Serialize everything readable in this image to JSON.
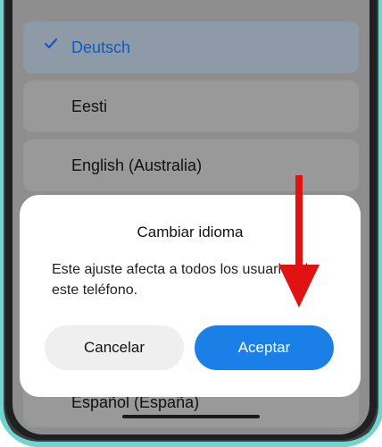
{
  "language_list": {
    "items": [
      {
        "label": "Deutsch",
        "selected": true
      },
      {
        "label": "Eesti",
        "selected": false
      },
      {
        "label": "English (Australia)",
        "selected": false
      },
      {
        "label": "Español (España)",
        "selected": false
      }
    ]
  },
  "dialog": {
    "title": "Cambiar idioma",
    "message": "Este ajuste afecta a todos los usuarios de este teléfono.",
    "cancel_label": "Cancelar",
    "accept_label": "Aceptar"
  },
  "colors": {
    "accent": "#1a7fe6",
    "selected_text": "#0b5bc0",
    "annotation_arrow": "#e01212",
    "frame_edge": "#6fd6cf"
  },
  "icons": {
    "selected_marker": "checkmark-icon",
    "annotation": "red-arrow-down-icon"
  }
}
